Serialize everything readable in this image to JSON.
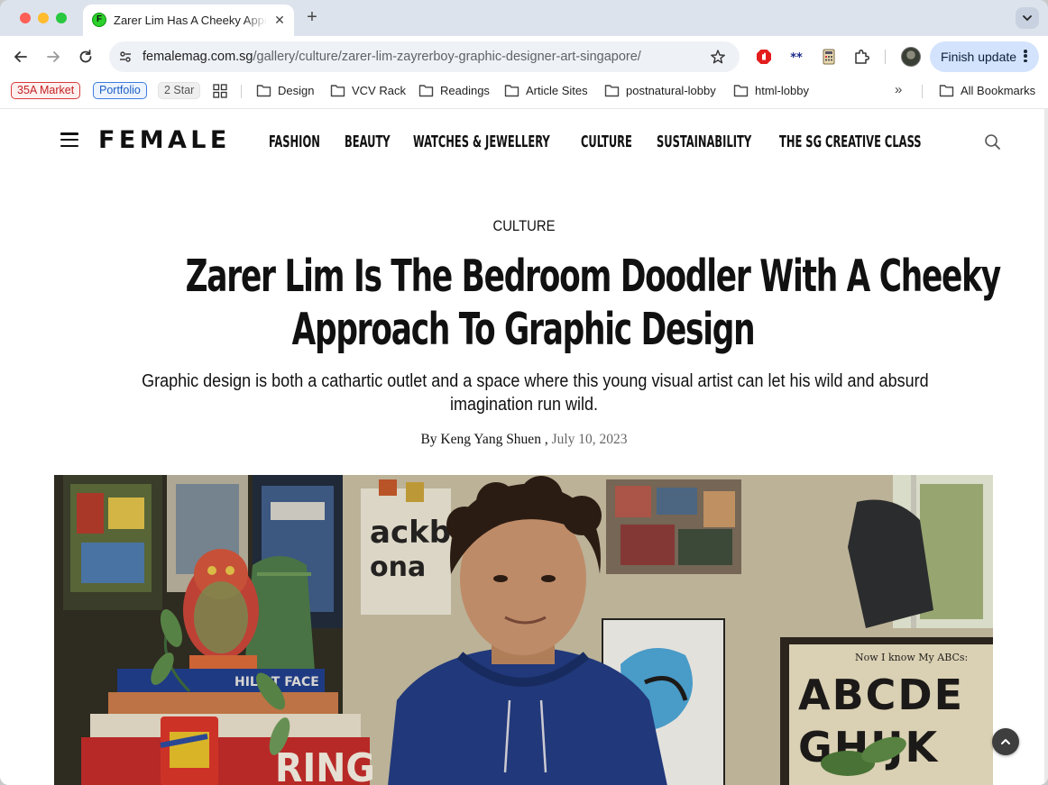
{
  "browser": {
    "tab_title": "Zarer Lim Has A Cheeky Approach To Graphic Design",
    "tab_favicon_letter": "F",
    "url_host": "femalemag.com.sg",
    "url_path": "/gallery/culture/zarer-lim-zayrerboy-graphic-designer-art-singapore/",
    "finish_update_label": "Finish update",
    "bookmark_chips": [
      "35A Market",
      "Portfolio",
      "2 Star"
    ],
    "bookmark_folders": [
      "Design",
      "VCV Rack",
      "Readings",
      "Article Sites",
      "postnatural-lobby",
      "html-lobby"
    ],
    "bookmarks_overflow": "»",
    "all_bookmarks_label": "All Bookmarks",
    "icons": [
      "back-arrow-icon",
      "forward-arrow-icon",
      "reload-icon",
      "site-settings-icon",
      "bookmark-star-icon",
      "adblock-extension-icon",
      "extension-icon",
      "calculator-extension-icon",
      "extensions-puzzle-icon",
      "profile-avatar",
      "apps-grid-icon",
      "folder-icon",
      "chevron-down-icon"
    ]
  },
  "site": {
    "logo": "FEMALE",
    "nav": [
      "FASHION",
      "BEAUTY",
      "WATCHES & JEWELLERY",
      "CULTURE",
      "SUSTAINABILITY",
      "THE SG CREATIVE CLASS"
    ],
    "menu_icon": "hamburger-menu-icon",
    "search_icon": "search-icon"
  },
  "article": {
    "category": "CULTURE",
    "headline_lines": [
      "Zarer Lim Is The Bedroom Doodler With A Cheeky",
      "Approach To Graphic Design"
    ],
    "dek_lines": [
      "Graphic design is both a cathartic outlet and a space where this young visual artist can let his wild and absurd",
      "imagination run wild."
    ],
    "byline_prefix": "By",
    "author": "Keng Yang Shuen",
    "byline_separator": ",",
    "date": "July 10, 2023",
    "hero_poster_text": "Now I know My ABCs:",
    "hero_book_text": "RING"
  },
  "colors": {
    "tabstrip": "#dde3ec",
    "omnibox": "#eef1f6",
    "finish_update_bg": "#d3e3fd",
    "chip_red": "#c42222",
    "chip_blue": "#1d5fc4",
    "text": "#111111"
  }
}
